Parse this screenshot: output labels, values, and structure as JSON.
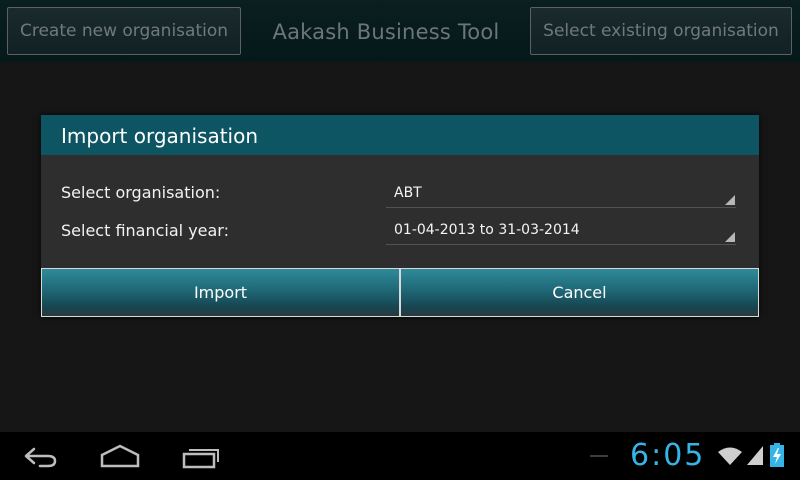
{
  "app": {
    "title": "Aakash Business Tool",
    "create_button": "Create new organisation",
    "select_button": "Select existing organisation"
  },
  "dialog": {
    "title": "Import organisation",
    "org_label": "Select organisation:",
    "org_value": "ABT",
    "year_label": "Select financial year:",
    "year_value": "01-04-2013 to 31-03-2014",
    "import_button": "Import",
    "cancel_button": "Cancel"
  },
  "status": {
    "time": "6:05"
  },
  "colors": {
    "accent": "#0d5563",
    "clock": "#35b5e5",
    "battery_charge": "#35b5e5"
  },
  "icons": {
    "back": "back-icon",
    "home": "home-icon",
    "recent": "recent-apps-icon",
    "wifi": "wifi-icon",
    "signal": "signal-icon",
    "battery": "battery-charging-icon"
  }
}
